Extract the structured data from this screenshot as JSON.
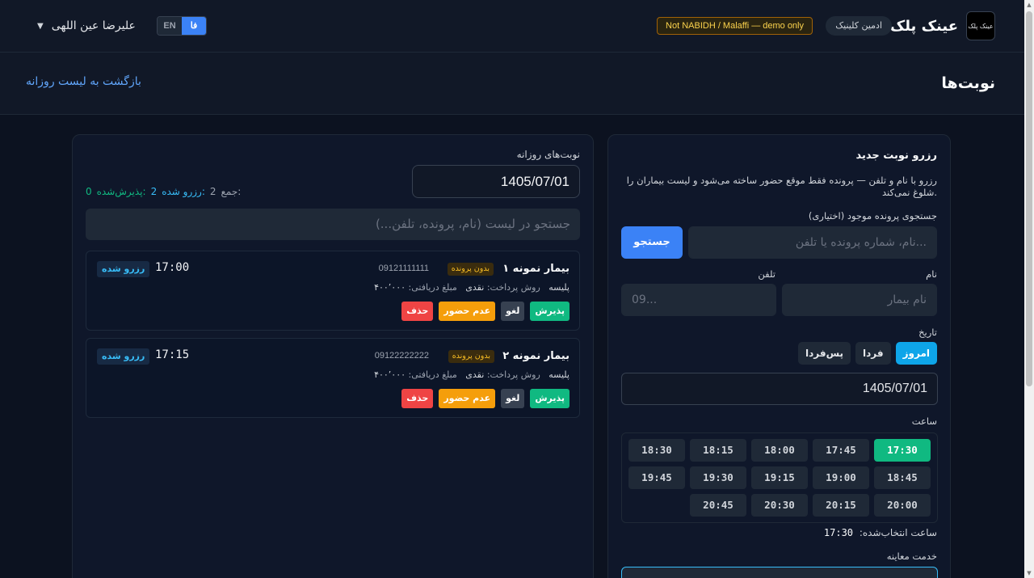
{
  "header": {
    "brand_name": "عینک پلک",
    "logo_text": "عینک پلک",
    "role": "ادمین کلینیک",
    "demo_badge": "Not NABIDH / Malaffi — demo only",
    "lang_fa": "فا",
    "lang_en": "EN",
    "user_name": "علیرضا عین اللهی"
  },
  "subheader": {
    "title": "نوبت‌ها",
    "back_link": "بازگشت به لیست روزانه"
  },
  "booking": {
    "title": "رزرو نوبت جدید",
    "description": "رزرو با نام و تلفن — پرونده فقط موقع حضور ساخته می‌شود و لیست بیماران را شلوغ نمی‌کند.",
    "search_label": "جستجوی پرونده موجود (اختیاری)",
    "search_placeholder": "نام، شماره پرونده یا تلفن...",
    "search_button": "جستجو",
    "name_label": "نام",
    "name_placeholder": "نام بیمار",
    "phone_label": "تلفن",
    "phone_placeholder": "09...",
    "date_label": "تاریخ",
    "date_buttons": [
      "امروز",
      "فردا",
      "پس‌فردا"
    ],
    "date_value": "1405/07/01",
    "time_label": "ساعت",
    "slots": [
      "17:30",
      "17:45",
      "18:00",
      "18:15",
      "18:30",
      "18:45",
      "19:00",
      "19:15",
      "19:30",
      "19:45",
      "20:00",
      "20:15",
      "20:30",
      "20:45"
    ],
    "selected_slot": "17:30",
    "selected_time_label": "ساعت انتخاب‌شده:",
    "selected_time_value": "17:30",
    "service_label": "خدمت معاینه"
  },
  "daily": {
    "label": "نوبت‌های روزانه",
    "date_value": "1405/07/01",
    "stats": {
      "total_label": "جمع:",
      "total": "2",
      "booked_label": "رزرو شده:",
      "booked": "2",
      "accepted_label": "پذیرش‌شده:",
      "accepted": "0"
    },
    "search_placeholder": "جستجو در لیست (نام، پرونده، تلفن...)",
    "appointments": [
      {
        "name": "بیمار نمونه ۱",
        "badge": "بدون پرونده",
        "phone": "09121111111",
        "insurance": "پلیسه",
        "payment_label": "روش پرداخت:",
        "payment": "نقدی",
        "amount_label": "مبلغ دریافتی:",
        "amount": "۴۰۰٬۰۰۰",
        "time": "17:00",
        "status": "رزرو شده",
        "actions": {
          "accept": "پذیرش",
          "cancel": "لغو",
          "noshow": "عدم حضور",
          "delete": "حذف"
        }
      },
      {
        "name": "بیمار نمونه ۲",
        "badge": "بدون پرونده",
        "phone": "09122222222",
        "insurance": "پلیسه",
        "payment_label": "روش پرداخت:",
        "payment": "نقدی",
        "amount_label": "مبلغ دریافتی:",
        "amount": "۴۰۰٬۰۰۰",
        "time": "17:15",
        "status": "رزرو شده",
        "actions": {
          "accept": "پذیرش",
          "cancel": "لغو",
          "noshow": "عدم حضور",
          "delete": "حذف"
        }
      }
    ]
  }
}
